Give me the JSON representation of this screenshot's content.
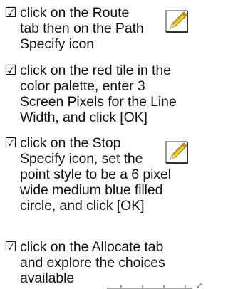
{
  "checkbox_glyph": "☑",
  "items": [
    {
      "lines": [
        "click on the Route",
        "tab then on the Path",
        "Specify icon"
      ],
      "icon": "pencil-icon"
    },
    {
      "lines": [
        "click on the red tile in the",
        "color palette, enter 3",
        "Screen Pixels for the Line",
        "Width, and click [OK]"
      ]
    },
    {
      "lines": [
        "click on the Stop",
        "Specify icon, set the",
        "point style to be a 6 pixel",
        "wide medium blue filled",
        "circle, and click [OK]"
      ],
      "icon": "pencil-icon"
    },
    {
      "lines": [
        "click on the Allocate tab",
        "and explore the choices",
        "available"
      ]
    }
  ]
}
